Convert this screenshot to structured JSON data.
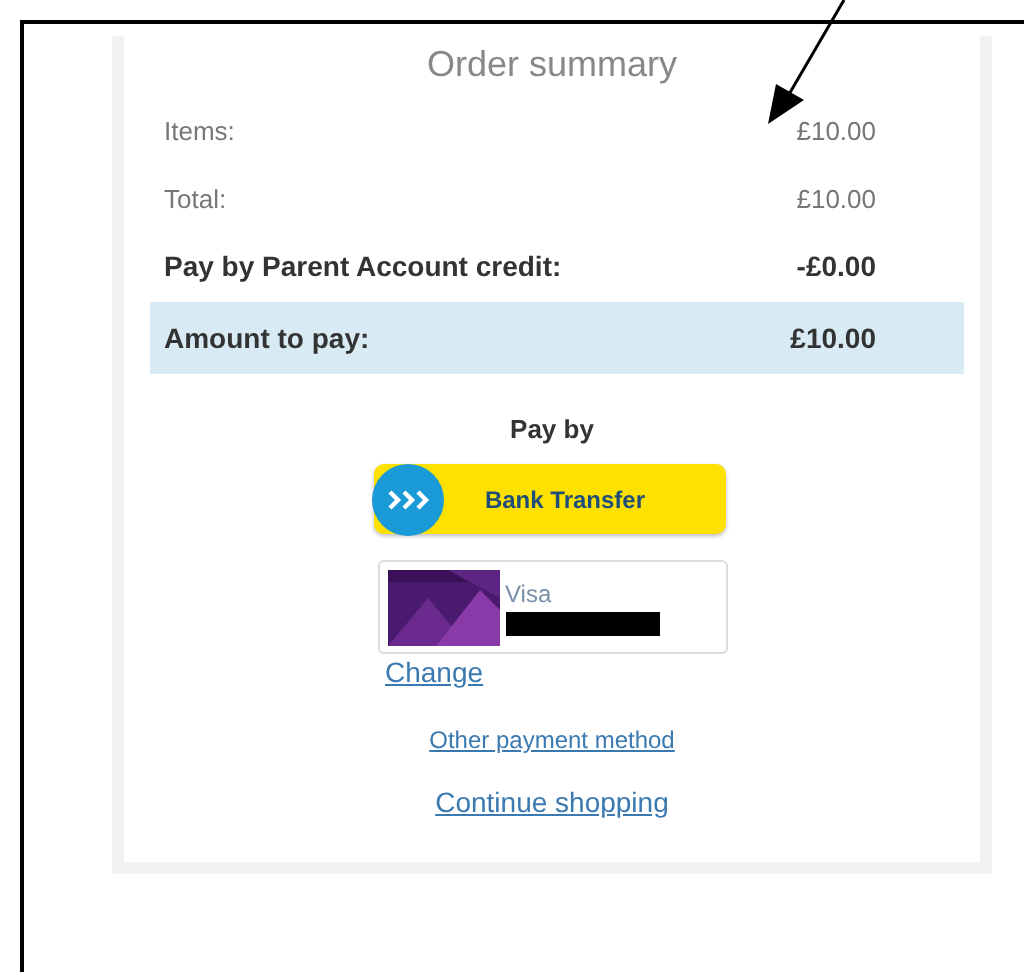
{
  "title": "Order summary",
  "rows": [
    {
      "label": "Items:",
      "value": "£10.00",
      "kind": "plain"
    },
    {
      "label": "Total:",
      "value": "£10.00",
      "kind": "plain"
    },
    {
      "label": "Pay by Parent Account credit:",
      "value": "-£0.00",
      "kind": "bold"
    },
    {
      "label": "Amount to pay:",
      "value": "£10.00",
      "kind": "highlight"
    }
  ],
  "pay_by": "Pay by",
  "bank_button": "Bank Transfer",
  "saved_card": {
    "label": "Visa",
    "number_hidden": true
  },
  "change_link": "Change",
  "other_link": "Other payment method",
  "continue_link": "Continue shopping"
}
